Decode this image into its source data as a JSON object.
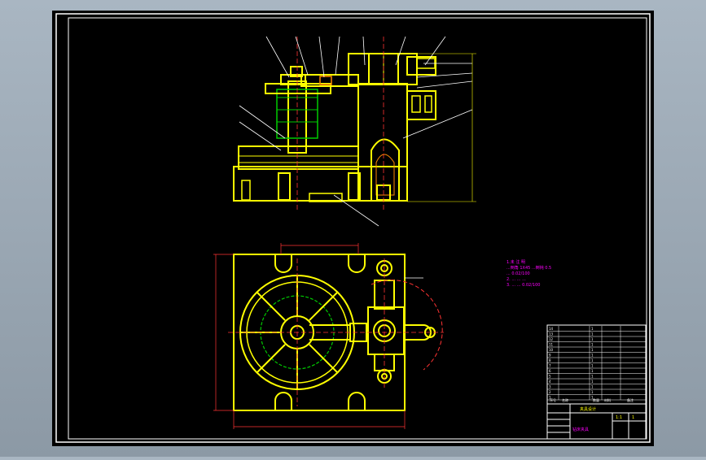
{
  "colors": {
    "background": "#000000",
    "frame": "#ffffff",
    "part": "#ffff00",
    "leader": "#ffffff",
    "dimension": "#ff4040",
    "hidden_circle": "#00c000",
    "note_text": "#ff00ff",
    "viewer_bg": "#9aa6b2"
  },
  "drawing": {
    "views": [
      "section-front-view",
      "top-plan-view"
    ],
    "tech_notes": [
      "1.未 注 明",
      "  ...倒角 1X45  ...倒钝 0.5",
      "  ...  0.02/100",
      "2.  ...  ...  ...",
      "3.  ...  ...  0.02/100"
    ]
  },
  "parts_list": {
    "rows": [
      {
        "no": "14",
        "name": "",
        "qty": "1",
        "material": "",
        "note": ""
      },
      {
        "no": "13",
        "name": "",
        "qty": "1",
        "material": "",
        "note": ""
      },
      {
        "no": "12",
        "name": "",
        "qty": "1",
        "material": "",
        "note": ""
      },
      {
        "no": "11",
        "name": "",
        "qty": "1",
        "material": "",
        "note": ""
      },
      {
        "no": "10",
        "name": "",
        "qty": "1",
        "material": "",
        "note": ""
      },
      {
        "no": "9",
        "name": "",
        "qty": "1",
        "material": "",
        "note": ""
      },
      {
        "no": "8",
        "name": "",
        "qty": "1",
        "material": "",
        "note": ""
      },
      {
        "no": "7",
        "name": "",
        "qty": "1",
        "material": "",
        "note": ""
      },
      {
        "no": "6",
        "name": "",
        "qty": "1",
        "material": "",
        "note": ""
      },
      {
        "no": "5",
        "name": "",
        "qty": "1",
        "material": "",
        "note": ""
      },
      {
        "no": "4",
        "name": "",
        "qty": "1",
        "material": "",
        "note": ""
      },
      {
        "no": "3",
        "name": "",
        "qty": "1",
        "material": "",
        "note": ""
      },
      {
        "no": "2",
        "name": "",
        "qty": "1",
        "material": "",
        "note": ""
      },
      {
        "no": "1",
        "name": "",
        "qty": "1",
        "material": "",
        "note": ""
      }
    ],
    "header": {
      "no": "序号",
      "name": "名称",
      "qty": "数量",
      "material": "材料",
      "note": "备注"
    }
  },
  "title_block": {
    "title": "夹具设计",
    "subtitle": "钻床夹具",
    "scale": "1:1",
    "sheet": "1"
  }
}
